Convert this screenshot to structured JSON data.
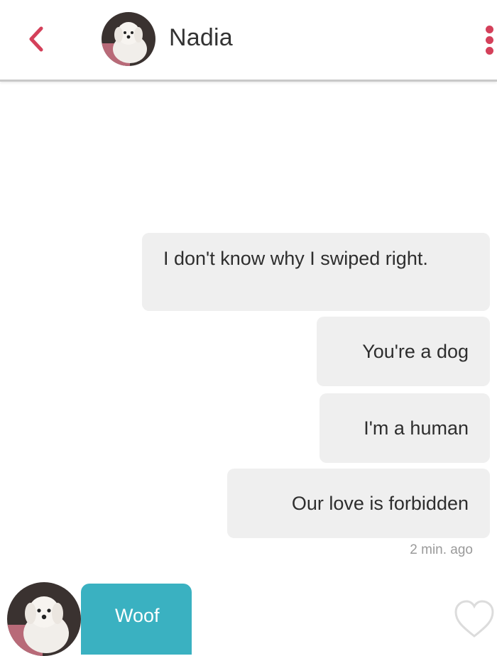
{
  "header": {
    "contact_name": "Nadia"
  },
  "icons": {
    "back": "chevron-left-icon",
    "more": "vertical-dots-icon",
    "like": "heart-outline-icon"
  },
  "colors": {
    "accent": "#d4405a",
    "incoming_bubble": "#3ab1c1",
    "outgoing_bubble": "#efefef"
  },
  "messages": {
    "outgoing": [
      {
        "text": "I don't know why I swiped right."
      },
      {
        "text": "You're a dog"
      },
      {
        "text": "I'm a human"
      },
      {
        "text": "Our love is forbidden"
      }
    ],
    "timestamp": "2 min. ago",
    "incoming": [
      {
        "text": "Woof"
      }
    ]
  }
}
